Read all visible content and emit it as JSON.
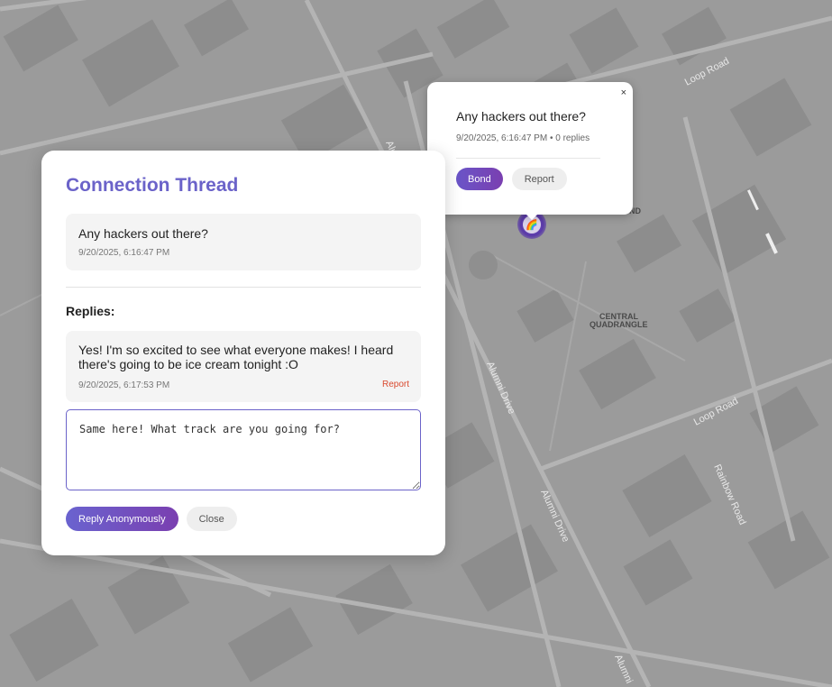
{
  "map": {
    "labels": {
      "loop_road_1": "Loop Road",
      "loop_road_2": "Loop Road",
      "alumni_drive_1": "Alumni Drive",
      "alumni_drive_2": "Alumni Drive",
      "alumni_drive_3": "Alumni",
      "alumni_drive_top": "Alum",
      "rainbow_road": "Rainbow Road",
      "central_quad_1": "CENTRAL",
      "central_quad_2": "QUADRANGLE",
      "partial_label": "ND"
    },
    "colors": {
      "base": "#9a9a9a",
      "roads": "#b2b2b2",
      "buildings": "#8c8c8c"
    }
  },
  "popup": {
    "close_label": "×",
    "title": "Any hackers out there?",
    "timestamp": "9/20/2025, 6:16:47 PM",
    "separator": "•",
    "replies_count": "0 replies",
    "bond_label": "Bond",
    "report_label": "Report"
  },
  "marker": {
    "icon": "rainbow-icon",
    "glyph": "🌈"
  },
  "panel": {
    "title": "Connection Thread",
    "post": {
      "text": "Any hackers out there?",
      "timestamp": "9/20/2025, 6:16:47 PM"
    },
    "replies_heading": "Replies:",
    "replies": [
      {
        "text": "Yes! I'm so excited to see what everyone makes! I heard there's going to be ice cream tonight :O",
        "timestamp": "9/20/2025, 6:17:53 PM",
        "report_label": "Report"
      }
    ],
    "reply_input_value": "Same here! What track are you going for?",
    "reply_button_label": "Reply Anonymously",
    "close_button_label": "Close"
  },
  "theme": {
    "accent": "#6b63c9",
    "danger": "#d9492e"
  }
}
